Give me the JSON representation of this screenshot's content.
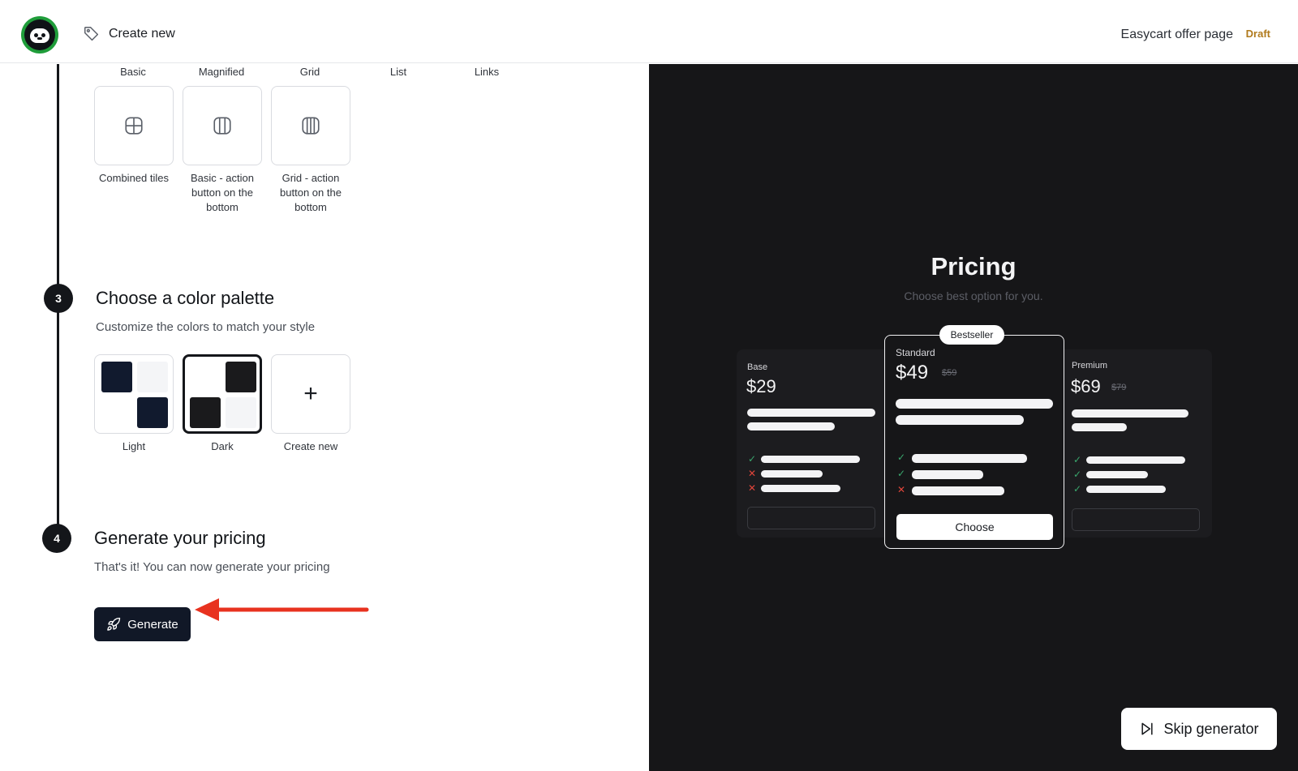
{
  "header": {
    "create_new_label": "Create new",
    "page_name": "Easycart offer page",
    "status_badge": "Draft"
  },
  "layout_section": {
    "layout_labels": [
      "Basic",
      "Magnified",
      "Grid",
      "List",
      "Links"
    ],
    "tiles": [
      {
        "caption": "Combined tiles",
        "icon": "combined-tiles-icon"
      },
      {
        "caption": "Basic - action button on the bottom",
        "icon": "basic-columns-icon"
      },
      {
        "caption": "Grid - action button on the bottom",
        "icon": "grid-columns-icon"
      }
    ]
  },
  "step3": {
    "number": "3",
    "title": "Choose a color palette",
    "description": "Customize the colors to match your style",
    "palettes": [
      {
        "label": "Light",
        "selected": false,
        "colors": [
          "#111a2e",
          "#f4f5f7",
          "#ffffff",
          "#111a2e"
        ]
      },
      {
        "label": "Dark",
        "selected": true,
        "colors": [
          "#ffffff",
          "#1a1a1c",
          "#1a1a1c",
          "#f4f5f7"
        ]
      },
      {
        "label": "Create new",
        "selected": false
      }
    ],
    "create_new_symbol": "+"
  },
  "step4": {
    "number": "4",
    "title": "Generate your pricing",
    "description": "That's it! You can now generate your pricing",
    "generate_label": "Generate"
  },
  "preview": {
    "title": "Pricing",
    "subtitle": "Choose best option for you.",
    "plans": [
      {
        "name": "Base",
        "price": "$29",
        "old_price": ""
      },
      {
        "name": "Standard",
        "price": "$49",
        "old_price": "$59",
        "badge": "Bestseller",
        "cta": "Choose"
      },
      {
        "name": "Premium",
        "price": "$69",
        "old_price": "$79"
      }
    ],
    "skip_label": "Skip generator"
  },
  "colors": {
    "accent_dark": "#111827",
    "preview_bg": "#161618",
    "check": "#3aa76d",
    "cross": "#e0453a",
    "arrow": "#e8321f"
  }
}
